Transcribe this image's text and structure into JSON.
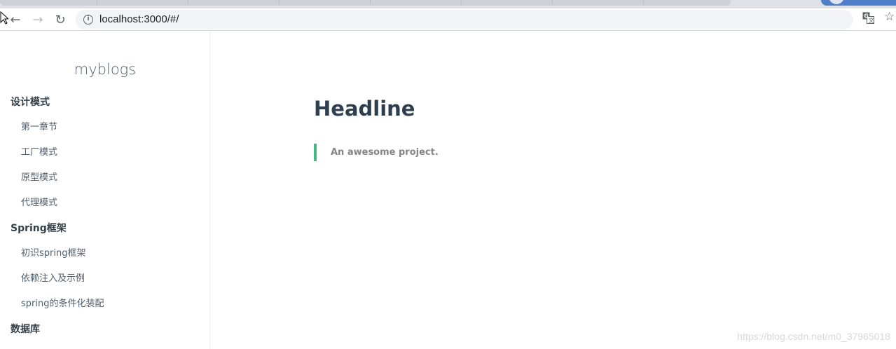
{
  "browser": {
    "url": "localhost:3000/#/",
    "back_icon": "arrow-left-icon",
    "forward_icon": "arrow-right-icon",
    "reload_icon": "reload-icon",
    "info_icon": "info-icon",
    "translate_icon": "translate-icon",
    "bookmark_icon": "star-icon"
  },
  "sidebar": {
    "app_name": "myblogs",
    "sections": [
      {
        "title": "设计模式",
        "items": [
          "第一章节",
          "工厂模式",
          "原型模式",
          "代理模式"
        ]
      },
      {
        "title": "Spring框架",
        "items": [
          "初识spring框架",
          "依赖注入及示例",
          "spring的条件化装配"
        ]
      },
      {
        "title": "数据库",
        "items": []
      }
    ]
  },
  "main": {
    "headline": "Headline",
    "tagline": "An awesome project.",
    "accent_color": "#42b983",
    "heading_color": "#2c3e50"
  },
  "watermark": "https://blog.csdn.net/m0_37965018"
}
